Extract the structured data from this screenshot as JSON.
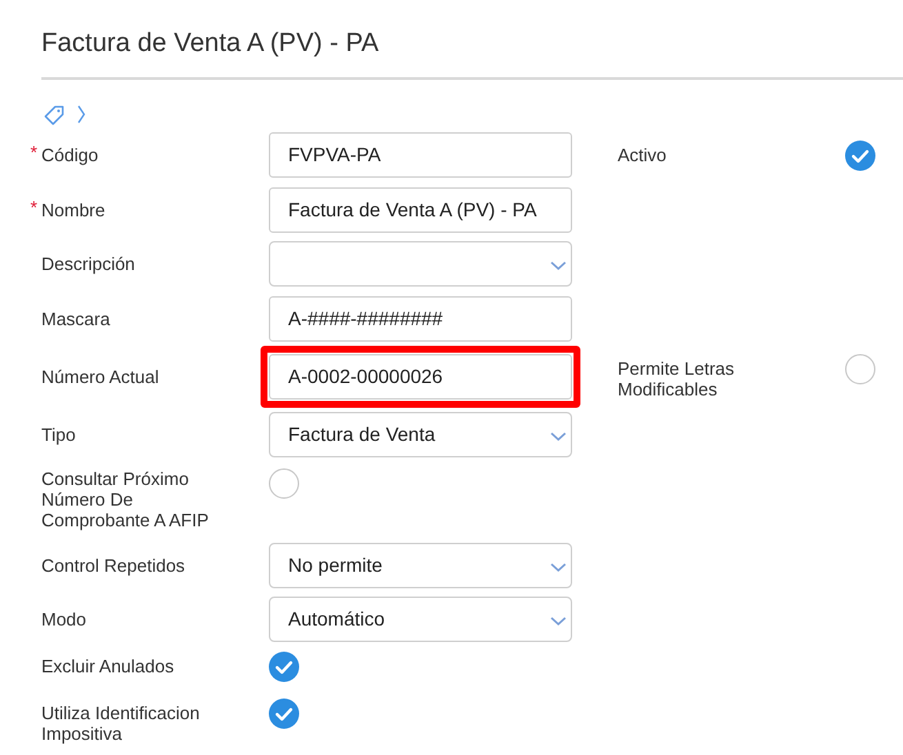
{
  "title": "Factura de Venta A (PV) - PA",
  "fields": [
    {
      "label": "Código",
      "marker": "*",
      "kind": "text",
      "value": "FVPVA-PA",
      "highlighted": false,
      "side": {
        "label": "Activo",
        "checked": true
      }
    },
    {
      "label": "Nombre",
      "marker": "*",
      "kind": "text",
      "value": "Factura de Venta A (PV) - PA",
      "highlighted": false
    },
    {
      "label": "Descripción",
      "kind": "select",
      "highlighted": false
    },
    {
      "label": "Mascara",
      "kind": "text",
      "value": "A-####-########",
      "highlighted": false
    },
    {
      "label": "Número Actual",
      "kind": "text",
      "value": "A-0002-00000026",
      "highlighted": true,
      "side": {
        "label": "Permite Letras Modificables",
        "checked": false
      }
    },
    {
      "label": "Tipo",
      "kind": "select",
      "value": "Factura de Venta",
      "highlighted": false
    },
    {
      "label": "Consultar Próximo Número De Comprobante A AFIP",
      "kind": "check",
      "checked": false
    },
    {
      "label": "Control Repetidos",
      "kind": "select",
      "value": "No permite",
      "highlighted": false
    },
    {
      "label": "Modo",
      "kind": "select",
      "value": "Automático",
      "highlighted": false
    },
    {
      "label": "Excluir Anulados",
      "kind": "check",
      "checked": true
    },
    {
      "label": "Utiliza Identificacion Impositiva",
      "kind": "check",
      "checked": true
    }
  ]
}
